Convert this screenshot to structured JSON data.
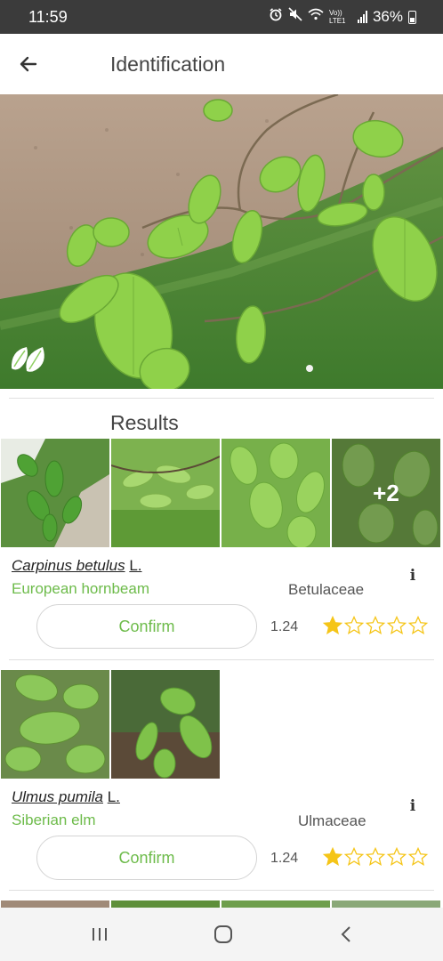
{
  "status_bar": {
    "time": "11:59",
    "network": "Vo)) LTE1",
    "battery_percent": "36%",
    "icons": [
      "alarm-icon",
      "mute-icon",
      "wifi-icon",
      "signal-icon",
      "battery-icon"
    ]
  },
  "app_bar": {
    "title": "Identification",
    "back_icon": "arrow-left-icon"
  },
  "hero": {
    "badge_icon": "leaf-icon"
  },
  "results": {
    "title": "Results",
    "items": [
      {
        "genus_species": "Carpinus betulus",
        "author": "L.",
        "common_name": "European hornbeam",
        "family": "Betulaceae",
        "confirm_label": "Confirm",
        "score": "1.24",
        "rating": 1,
        "rating_max": 5,
        "extra_images_label": "+2"
      },
      {
        "genus_species": "Ulmus pumila",
        "author": "L.",
        "common_name": "Siberian elm",
        "family": "Ulmaceae",
        "confirm_label": "Confirm",
        "score": "1.24",
        "rating": 1,
        "rating_max": 5
      }
    ]
  },
  "nav_bar": {
    "icons": [
      "recent-apps-icon",
      "home-icon",
      "back-icon"
    ]
  },
  "colors": {
    "accent_green": "#6dbb4a",
    "star_gold": "#f5c518",
    "status_bar_bg": "#3b3b3b"
  }
}
